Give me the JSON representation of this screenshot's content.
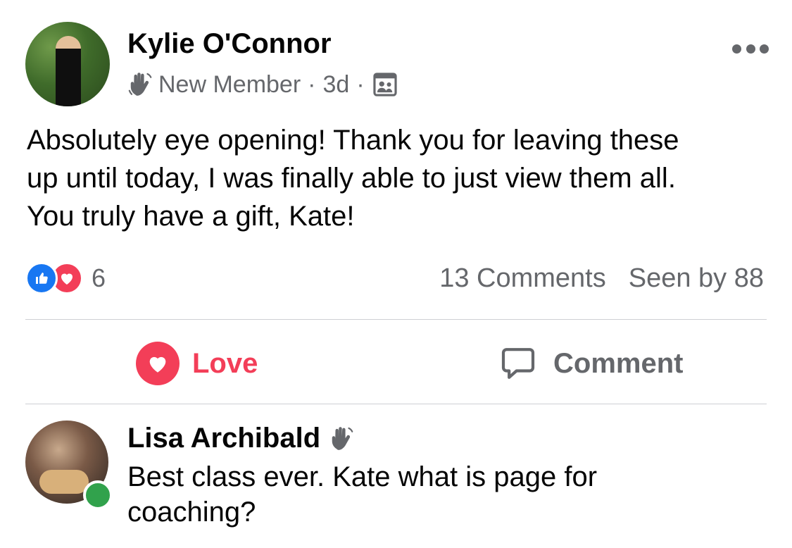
{
  "post": {
    "author": "Kylie O'Connor",
    "badge": "New Member",
    "time_separator": "·",
    "time": "3d",
    "privacy_separator": "·",
    "privacy_icon": "group-icon",
    "badge_icon": "waving-hand-icon",
    "text_lines": [
      "Absolutely eye opening! Thank you for leaving these",
      "up until today, I was finally able to just view them all.",
      "You truly have a gift, Kate!"
    ],
    "reactions": {
      "icons": [
        "like-icon",
        "love-icon"
      ],
      "count": "6"
    },
    "comments_count": "13 Comments",
    "seen_by": "Seen by 88"
  },
  "actions": {
    "love_label": "Love",
    "comment_label": "Comment"
  },
  "comment": {
    "author": "Lisa Archibald",
    "author_badge_icon": "waving-hand-icon",
    "text_lines": [
      "Best class ever. Kate what is page for",
      "coaching?"
    ],
    "status": "online"
  },
  "colors": {
    "love_red": "#f33e58",
    "like_blue": "#1877f2",
    "secondary_text": "#65676b",
    "online_green": "#31a24c"
  }
}
